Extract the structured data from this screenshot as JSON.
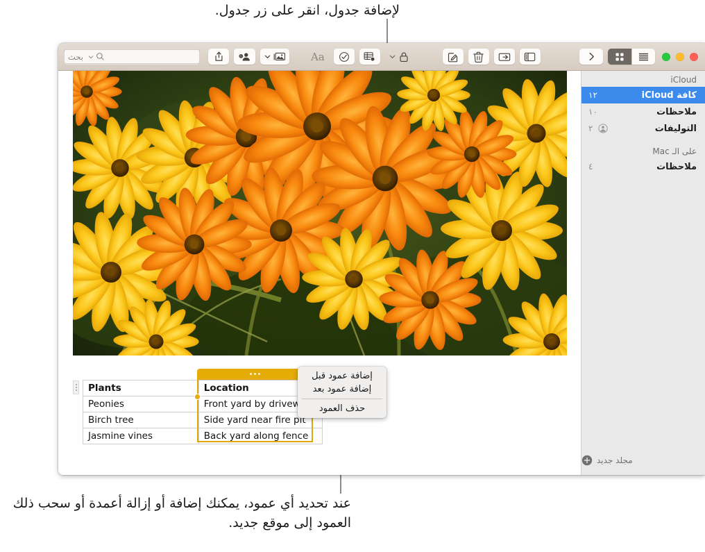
{
  "callouts": {
    "top": "لإضافة جدول، انقر على زر جدول.",
    "bottom": "عند تحديد أي عمود، يمكنك إضافة أو إزالة أعمدة أو سحب ذلك العمود إلى موقع جديد."
  },
  "toolbar": {
    "search_placeholder": "بحث",
    "buttons": [
      {
        "name": "search-field",
        "icon": "search-icon"
      },
      {
        "name": "share-button",
        "icon": "share-icon"
      },
      {
        "name": "add-people-button",
        "icon": "add-person-icon"
      },
      {
        "name": "media-button",
        "icon": "media-icon"
      },
      {
        "name": "format-button",
        "icon": "format-aa-icon"
      },
      {
        "name": "checklist-button",
        "icon": "checklist-icon"
      },
      {
        "name": "table-button",
        "icon": "table-icon"
      },
      {
        "name": "lock-button",
        "icon": "lock-icon"
      },
      {
        "name": "compose-button",
        "icon": "compose-icon"
      },
      {
        "name": "delete-button",
        "icon": "trash-icon"
      },
      {
        "name": "move-to-folder-button",
        "icon": "move-folder-icon"
      },
      {
        "name": "sidebar-toggle-button",
        "icon": "sidebar-icon"
      },
      {
        "name": "expand-button",
        "icon": "chevron-right-icon"
      },
      {
        "name": "gallery-view-button",
        "icon": "grid-view-icon"
      },
      {
        "name": "list-view-button",
        "icon": "list-view-icon"
      }
    ],
    "view_selected": "gallery",
    "traffic_lights": [
      "green",
      "yellow",
      "red"
    ],
    "accent_color": "#3c8bec"
  },
  "sidebar": {
    "sections": [
      {
        "title": "iCloud",
        "items": [
          {
            "label": "كافة iCloud",
            "count": "١٢",
            "selected": true,
            "shared": false
          },
          {
            "label": "ملاحظات",
            "count": "١٠",
            "selected": false,
            "shared": false
          },
          {
            "label": "التوليفات",
            "count": "٢",
            "selected": false,
            "shared": true
          }
        ]
      },
      {
        "title": "على الـ Mac",
        "items": [
          {
            "label": "ملاحظات",
            "count": "٤",
            "selected": false,
            "shared": false
          }
        ]
      }
    ],
    "footer": {
      "new_folder_label": "مجلد جديد",
      "icon": "plus-circle-icon"
    }
  },
  "note": {
    "photo_alt": "photo-of-orange-and-yellow-daisies",
    "table": {
      "headers": [
        "Plants",
        "Location"
      ],
      "rows": [
        [
          "Peonies",
          "Front yard by driveway"
        ],
        [
          "Birch tree",
          "Side yard near fire pit"
        ],
        [
          "Jasmine vines",
          "Back yard along fence"
        ]
      ],
      "selected_column_index": 1,
      "selection_color": "#e5ac07"
    }
  },
  "context_menu": {
    "items": [
      {
        "label": "إضافة عمود قبل",
        "separator_after": false
      },
      {
        "label": "إضافة عمود بعد",
        "separator_after": true
      },
      {
        "label": "حذف العمود",
        "separator_after": false
      }
    ]
  }
}
